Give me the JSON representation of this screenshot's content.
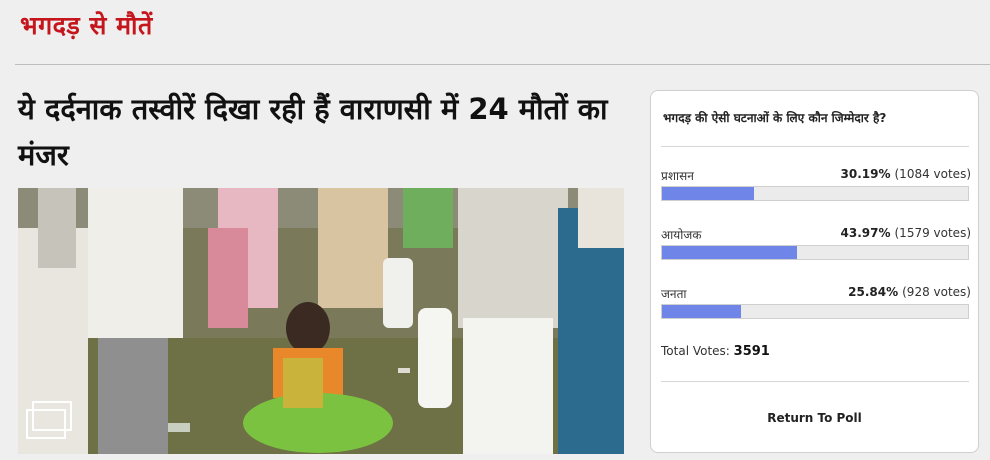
{
  "section": {
    "title": "भगदड़ से मौतें"
  },
  "article": {
    "headline": "ये दर्दनाक तस्वीरें दिखा रही हैं वाराणसी में 24 मौतों का मंजर"
  },
  "poll": {
    "question": "भगदड़ की ऐसी घटनाओं के लिए कौन जिम्मेदार है?",
    "options": [
      {
        "label": "प्रशासन",
        "percent_text": "30.19%",
        "votes_text": "(1084 votes)",
        "percent": 30.19
      },
      {
        "label": "आयोजक",
        "percent_text": "43.97%",
        "votes_text": "(1579 votes)",
        "percent": 43.97
      },
      {
        "label": "जनता",
        "percent_text": "25.84%",
        "votes_text": "(928 votes)",
        "percent": 25.84
      }
    ],
    "total_label": "Total Votes:",
    "total_value": "3591",
    "return_label": "Return To Poll",
    "bar_color": "#6f86e8"
  },
  "colors": {
    "section_red": "#c4161c"
  }
}
